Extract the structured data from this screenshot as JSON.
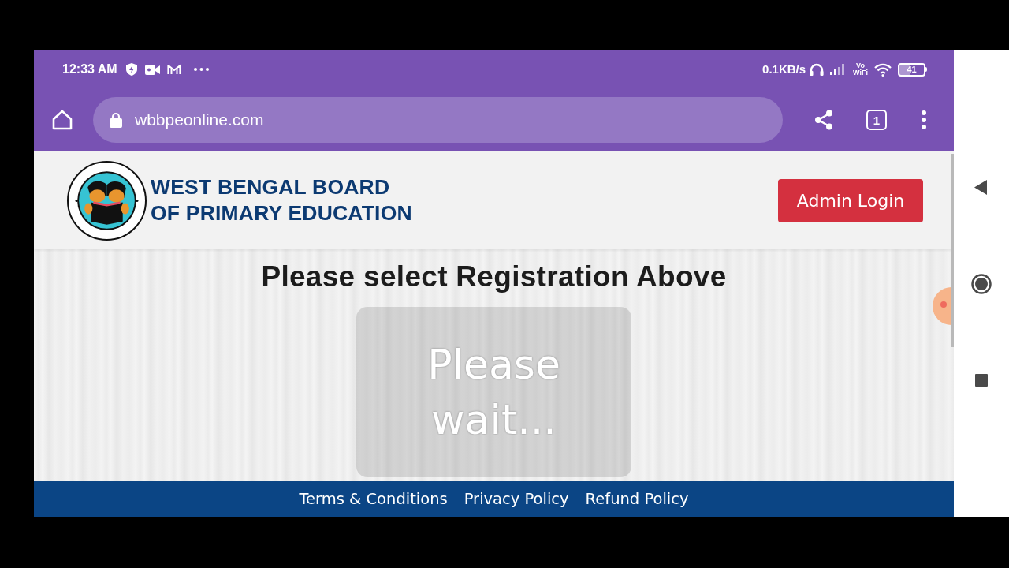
{
  "status_bar": {
    "time": "12:33 AM",
    "network_speed": "0.1KB/s",
    "vowifi": [
      "Vo",
      "WiFi"
    ],
    "battery": "41"
  },
  "browser_toolbar": {
    "url": "wbbpeonline.com",
    "tab_count": "1"
  },
  "site_header": {
    "title_lines": [
      "WEST BENGAL BOARD",
      "OF PRIMARY EDUCATION"
    ],
    "admin_button": "Admin Login"
  },
  "main": {
    "heading": "Please select Registration Above",
    "loading_overlay": "Please wait..."
  },
  "footer": {
    "links": [
      "Terms & Conditions",
      "Privacy Policy",
      "Refund Policy"
    ]
  }
}
